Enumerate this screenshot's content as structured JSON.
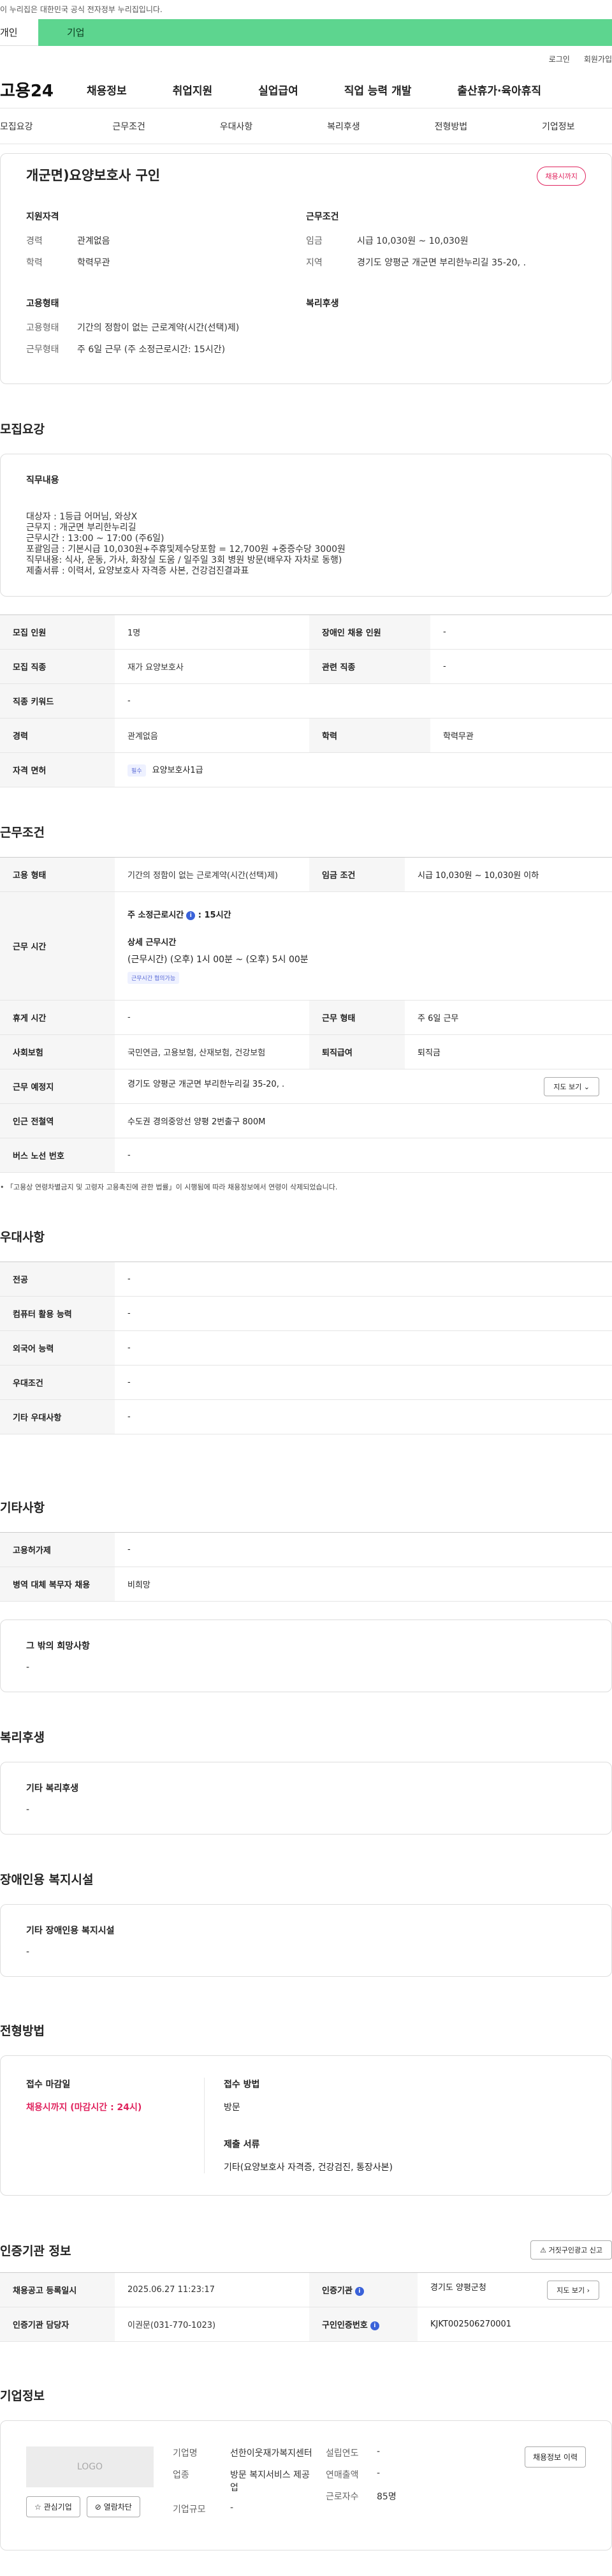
{
  "top_notice": "이 누리집은 대한민국 공식 전자정부 누리집입니다.",
  "user_tabs": {
    "person": "개인",
    "company": "기업"
  },
  "util": {
    "login": "로그인",
    "join": "회원가입"
  },
  "gnb": {
    "logo": "고용24",
    "menus": [
      "채용정보",
      "취업지원",
      "실업급여",
      "직업 능력 개발",
      "출산휴가·육아휴직"
    ]
  },
  "anchors": [
    "모집요강",
    "근무조건",
    "우대사항",
    "복리후생",
    "전형방법",
    "기업정보"
  ],
  "summary": {
    "title": "개군면)요양보호사 구인",
    "status_badge": "채용시까지",
    "qual_title": "지원자격",
    "qual": [
      {
        "k": "경력",
        "v": "관계없음"
      },
      {
        "k": "학력",
        "v": "학력무관"
      }
    ],
    "emp_title": "고용형태",
    "emp": [
      {
        "k": "고용형태",
        "v": "기간의 정함이 없는 근로계약(시간(선택)제)"
      },
      {
        "k": "근무형태",
        "v": "주 6일 근무 (주 소정근로시간: 15시간)"
      }
    ],
    "cond_title": "근무조건",
    "cond": [
      {
        "k": "임금",
        "v": "시급 10,030원 ~ 10,030원"
      },
      {
        "k": "지역",
        "v": "경기도 양평군 개군면 부리한누리길 35-20, ."
      }
    ],
    "welfare_title": "복리후생"
  },
  "recruit": {
    "section_title": "모집요강",
    "duty_title": "직무내용",
    "duty_text": "대상자 : 1등급 어머님, 와상X\n근무지 : 개군면 부리한누리길\n근무시간 : 13:00 ~ 17:00 (주6일)\n포괄임금 : 기본시급 10,030원+주휴및제수당포함 = 12,700원 +중증수당 3000원\n직무내용: 식사, 운동, 가사, 화장실 도움 / 일주일 3회 병원 방문(배우자 자차로 동행)\n제출서류 : 이력서, 요양보호사 자격증 사본, 건강검진결과표",
    "rows": [
      {
        "k1": "모집 인원",
        "v1": "1명",
        "k2": "장애인 채용 인원",
        "v2": "-"
      },
      {
        "k1": "모집 직종",
        "v1": "재가 요양보호사",
        "k2": "관련 직종",
        "v2": "-"
      },
      {
        "k1": "직종 키워드",
        "v1": "-"
      },
      {
        "k1": "경력",
        "v1": "관계없음",
        "k2": "학력",
        "v2": "학력무관"
      }
    ],
    "license_label": "자격 면허",
    "license_chip": "필수",
    "license_value": "요양보호사1급"
  },
  "work": {
    "section_title": "근무조건",
    "emp_type_label": "고용 형태",
    "emp_type": "기간의 정함이 없는 근로계약(시간(선택)제)",
    "wage_label": "임금 조건",
    "wage": "시급 10,030원 ~ 10,030원 이하",
    "hours_label": "근무 시간",
    "hours_week": "주 소정근로시간",
    "hours_week_value": ": 15시간",
    "hours_detail_title": "상세 근무시간",
    "hours_detail": "(근무시간) (오후) 1시 00분 ~ (오후) 5시 00분",
    "hours_chip": "근무시간 협의가능",
    "rest_label": "휴게 시간",
    "rest": "-",
    "form_label": "근무 형태",
    "form": "주 6일 근무",
    "ins_label": "사회보험",
    "ins": "국민연금, 고용보험, 산재보험, 건강보험",
    "sev_label": "퇴직급여",
    "sev": "퇴직금",
    "place_label": "근무 예정지",
    "place": "경기도 양평군 개군면 부리한누리길 35-20, .",
    "map_btn": "지도 보기",
    "station_label": "인근 전철역",
    "station": "수도권 경의중앙선 양평 2번출구 800M",
    "bus_label": "버스 노선 번호",
    "bus": "-",
    "note": "「고용상 연령차별금지 및 고령자 고용촉진에 관한 법률」이 시행됨에 따라 채용정보에서 연령이 삭제되었습니다."
  },
  "pref": {
    "section_title": "우대사항",
    "rows": [
      {
        "k": "전공",
        "v": "-"
      },
      {
        "k": "컴퓨터 활용 능력",
        "v": "-"
      },
      {
        "k": "외국어 능력",
        "v": "-"
      },
      {
        "k": "우대조건",
        "v": "-"
      },
      {
        "k": "기타 우대사항",
        "v": "-"
      }
    ]
  },
  "etc": {
    "section_title": "기타사항",
    "rows": [
      {
        "k": "고용허가제",
        "v": "-"
      },
      {
        "k": "병역 대체 복무자 채용",
        "v": "비희망"
      }
    ],
    "wish_title": "그 밖의 희망사항",
    "wish": "-"
  },
  "welfare": {
    "section_title": "복리후생",
    "box_title": "기타 복리후생",
    "box_value": "-"
  },
  "disabled": {
    "section_title": "장애인용 복지시설",
    "box_title": "기타 장애인용 복지시설",
    "box_value": "-"
  },
  "screening": {
    "section_title": "전형방법",
    "deadline_title": "접수 마감일",
    "deadline": "채용시까지 (마감시간 : 24시)",
    "method_title": "접수 방법",
    "method": "방문",
    "docs_title": "제출 서류",
    "docs": "기타(요양보호사 자격증, 건강검진, 통장사본)"
  },
  "agency": {
    "section_title": "인증기관 정보",
    "report_btn": "거짓구인광고 신고",
    "rows": [
      {
        "k1": "채용공고 등록일시",
        "v1": "2025.06.27 11:23:17",
        "k2": "인증기관",
        "v2": "경기도 양평군청"
      },
      {
        "k1": "인증기관 담당자",
        "v1": "이권문(031-770-1023)",
        "k2": "구인인증번호",
        "v2": "KJKT002506270001"
      }
    ],
    "map_btn": "지도 보기"
  },
  "company": {
    "section_title": "기업정보",
    "logo_text": "LOGO",
    "fav_btn": "관심기업",
    "block_btn": "열람차단",
    "fields": [
      {
        "k": "기업명",
        "v": "선한이웃재가복지센터"
      },
      {
        "k": "업종",
        "v": "방문 복지서비스 제공업"
      },
      {
        "k": "기업규모",
        "v": "-"
      }
    ],
    "fields2": [
      {
        "k": "설립연도",
        "v": "-"
      },
      {
        "k": "연매출액",
        "v": "-"
      },
      {
        "k": "근로자수",
        "v": "85명"
      }
    ],
    "history_btn": "채용정보 이력"
  }
}
